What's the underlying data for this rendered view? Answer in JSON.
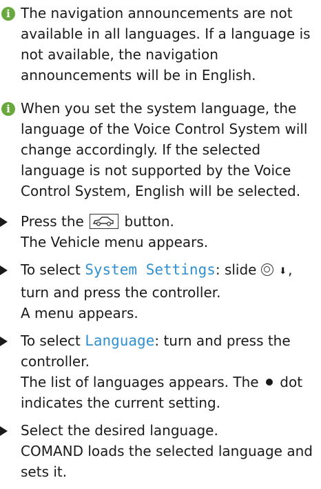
{
  "notes": [
    {
      "icon": "info-icon",
      "text": "The navigation announcements are not available in all languages. If a language is not available, the navigation announcements will be in English."
    },
    {
      "icon": "info-icon",
      "text": "When you set the system language, the language of the Voice Control System will change accordingly. If the selected language is not supported by the Voice Control System, English will be selected."
    }
  ],
  "steps": [
    {
      "pre": "Press the",
      "button_icon": "vehicle-button-icon",
      "post": "button.",
      "result": "The Vehicle menu appears."
    },
    {
      "pre": "To select",
      "highlight": "System Settings",
      "mid": ": slide",
      "controller_icon": "controller-icon",
      "arrow": "⬇",
      "post": ",",
      "line2": "turn and press the controller.",
      "result": "A menu appears."
    },
    {
      "pre": "To select",
      "highlight": "Language",
      "post": ": turn and press the controller.",
      "result_pre": "The list of languages appears. The",
      "result_icon": "dot-icon",
      "result_post": "dot indicates the current setting."
    },
    {
      "text": "Select the desired language.",
      "result": "COMAND loads the selected language and sets it."
    }
  ],
  "colors": {
    "info_icon": "#68a83d",
    "highlight": "#2f8fd0",
    "text": "#1a1a1a"
  }
}
